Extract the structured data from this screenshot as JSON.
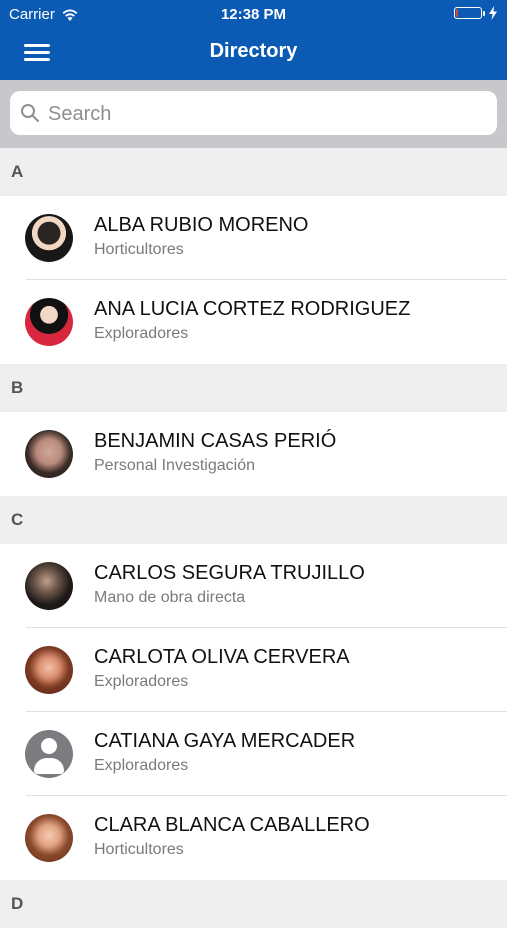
{
  "status_bar": {
    "carrier": "Carrier",
    "time": "12:38 PM",
    "battery_level": 0.1
  },
  "nav": {
    "title": "Directory"
  },
  "search": {
    "placeholder": "Search",
    "value": ""
  },
  "sections": [
    {
      "letter": "A",
      "people": [
        {
          "name": "ALBA RUBIO MORENO",
          "role": "Horticultores"
        },
        {
          "name": "ANA LUCIA CORTEZ RODRIGUEZ",
          "role": "Exploradores"
        }
      ]
    },
    {
      "letter": "B",
      "people": [
        {
          "name": "BENJAMIN CASAS PERIÓ",
          "role": "Personal Investigación"
        }
      ]
    },
    {
      "letter": "C",
      "people": [
        {
          "name": "CARLOS SEGURA TRUJILLO",
          "role": "Mano de obra directa"
        },
        {
          "name": "CARLOTA OLIVA CERVERA",
          "role": "Exploradores"
        },
        {
          "name": "CATIANA GAYA MERCADER",
          "role": "Exploradores"
        },
        {
          "name": "CLARA BLANCA CABALLERO",
          "role": "Horticultores"
        }
      ]
    },
    {
      "letter": "D",
      "people": []
    }
  ],
  "colors": {
    "nav_bg": "#0b5bb5",
    "battery_low": "#e0403c"
  }
}
